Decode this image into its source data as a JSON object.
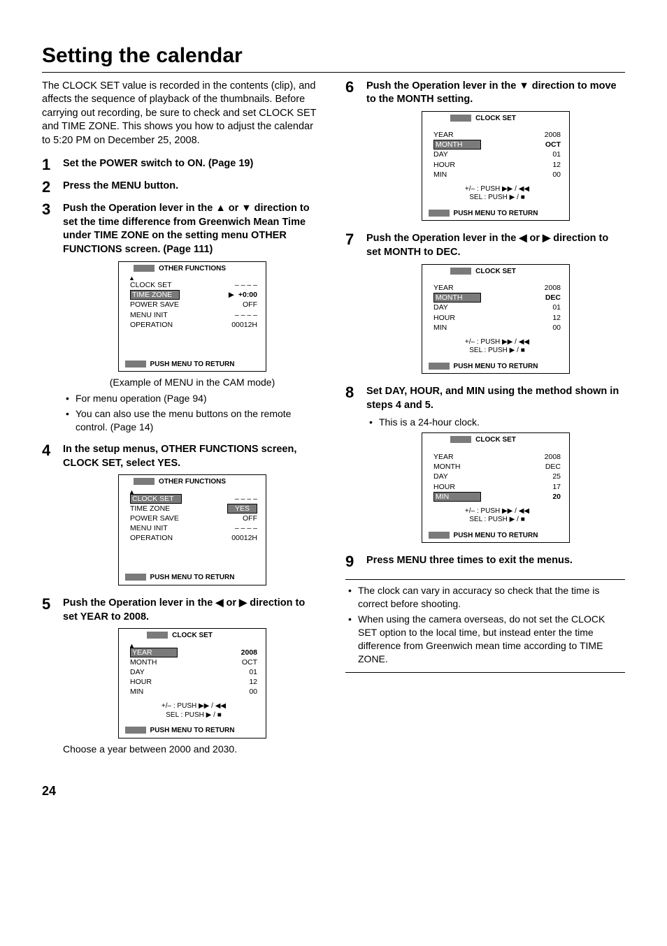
{
  "title": "Setting the calendar",
  "intro": "The CLOCK SET value is recorded in the contents (clip), and affects the sequence of playback of the thumbnails. Before carrying out recording, be sure to check and set CLOCK SET and TIME ZONE. This shows you how to adjust the calendar to 5:20 PM on December 25, 2008.",
  "steps": {
    "s1": "Set the POWER switch to ON. (Page 19)",
    "s2": "Press the MENU button.",
    "s3": "Push the Operation lever in the ▲ or ▼ direction to set the time difference from Greenwich Mean Time under TIME ZONE on the setting menu OTHER FUNCTIONS screen. (Page 111)",
    "s3_example": "(Example of MENU in the CAM mode)",
    "s3_bullets": [
      "For menu operation (Page 94)",
      "You can also use the menu buttons on the remote control. (Page 14)"
    ],
    "s4": "In the setup menus, OTHER FUNCTIONS screen, CLOCK SET, select YES.",
    "s5": "Push the Operation lever in the ◀ or ▶ direction to set YEAR to 2008.",
    "s5_after": "Choose a year between 2000 and 2030.",
    "s6": "Push the Operation lever in the ▼ direction to move to the MONTH setting.",
    "s7": "Push the Operation lever in the ◀ or ▶ direction to set MONTH to DEC.",
    "s8": "Set DAY, HOUR, and MIN using the method shown in steps 4 and 5.",
    "s8_bullet": "This is a 24-hour clock.",
    "s9": "Press MENU three times to exit the menus."
  },
  "panels": {
    "other_funcs": {
      "title": "OTHER FUNCTIONS",
      "rows": [
        {
          "l": "CLOCK SET",
          "r": "– – – –"
        },
        {
          "l": "TIME ZONE",
          "r": "+0:00",
          "hl": true,
          "ptr": true
        },
        {
          "l": "POWER SAVE",
          "r": "OFF"
        },
        {
          "l": "MENU INIT",
          "r": "– – – –"
        },
        {
          "l": "OPERATION",
          "r": "00012H"
        }
      ],
      "footer": "PUSH  MENU TO RETURN"
    },
    "other_funcs_yes": {
      "title": "OTHER FUNCTIONS",
      "rows": [
        {
          "l": "CLOCK SET",
          "r": "– – – –",
          "hl": true,
          "rbox": "YES"
        },
        {
          "l": "TIME ZONE",
          "r": ""
        },
        {
          "l": "POWER SAVE",
          "r": "OFF"
        },
        {
          "l": "MENU INIT",
          "r": "– – – –"
        },
        {
          "l": "OPERATION",
          "r": "00012H"
        }
      ],
      "footer": "PUSH  MENU TO RETURN"
    },
    "clock5": {
      "title": "CLOCK SET",
      "rows": [
        {
          "l": "YEAR",
          "r": "2008",
          "hl": true,
          "rbold": true
        },
        {
          "l": "MONTH",
          "r": "OCT"
        },
        {
          "l": "DAY",
          "r": "01"
        },
        {
          "l": "HOUR",
          "r": "12"
        },
        {
          "l": "MIN",
          "r": "00"
        }
      ],
      "controls": [
        "+/– : PUSH ▶▶ / ◀◀",
        "SEL : PUSH ▶ / ■"
      ],
      "footer": "PUSH  MENU TO RETURN"
    },
    "clock6": {
      "title": "CLOCK SET",
      "rows": [
        {
          "l": "YEAR",
          "r": "2008"
        },
        {
          "l": "MONTH",
          "r": "OCT",
          "hl": true,
          "rbold": true
        },
        {
          "l": "DAY",
          "r": "01"
        },
        {
          "l": "HOUR",
          "r": "12"
        },
        {
          "l": "MIN",
          "r": "00"
        }
      ],
      "controls": [
        "+/– : PUSH ▶▶ / ◀◀",
        "SEL : PUSH ▶ / ■"
      ],
      "footer": "PUSH  MENU TO RETURN"
    },
    "clock7": {
      "title": "CLOCK SET",
      "rows": [
        {
          "l": "YEAR",
          "r": "2008"
        },
        {
          "l": "MONTH",
          "r": "DEC",
          "hl": true,
          "rbold": true
        },
        {
          "l": "DAY",
          "r": "01"
        },
        {
          "l": "HOUR",
          "r": "12"
        },
        {
          "l": "MIN",
          "r": "00"
        }
      ],
      "controls": [
        "+/– : PUSH ▶▶ / ◀◀",
        "SEL : PUSH ▶ / ■"
      ],
      "footer": "PUSH  MENU TO RETURN"
    },
    "clock8": {
      "title": "CLOCK SET",
      "rows": [
        {
          "l": "YEAR",
          "r": "2008"
        },
        {
          "l": "MONTH",
          "r": "DEC"
        },
        {
          "l": "DAY",
          "r": "25"
        },
        {
          "l": "HOUR",
          "r": "17"
        },
        {
          "l": "MIN",
          "r": "20",
          "hl": true,
          "rbold": true
        }
      ],
      "controls": [
        "+/– : PUSH ▶▶ / ◀◀",
        "SEL : PUSH ▶ / ■"
      ],
      "footer": "PUSH  MENU TO RETURN"
    }
  },
  "tips": [
    "The clock can vary in accuracy so check that the time is correct before shooting.",
    "When using the camera overseas, do not set the CLOCK SET option to the local time, but instead enter the time difference from Greenwich mean time according to TIME ZONE."
  ],
  "pagenum": "24"
}
